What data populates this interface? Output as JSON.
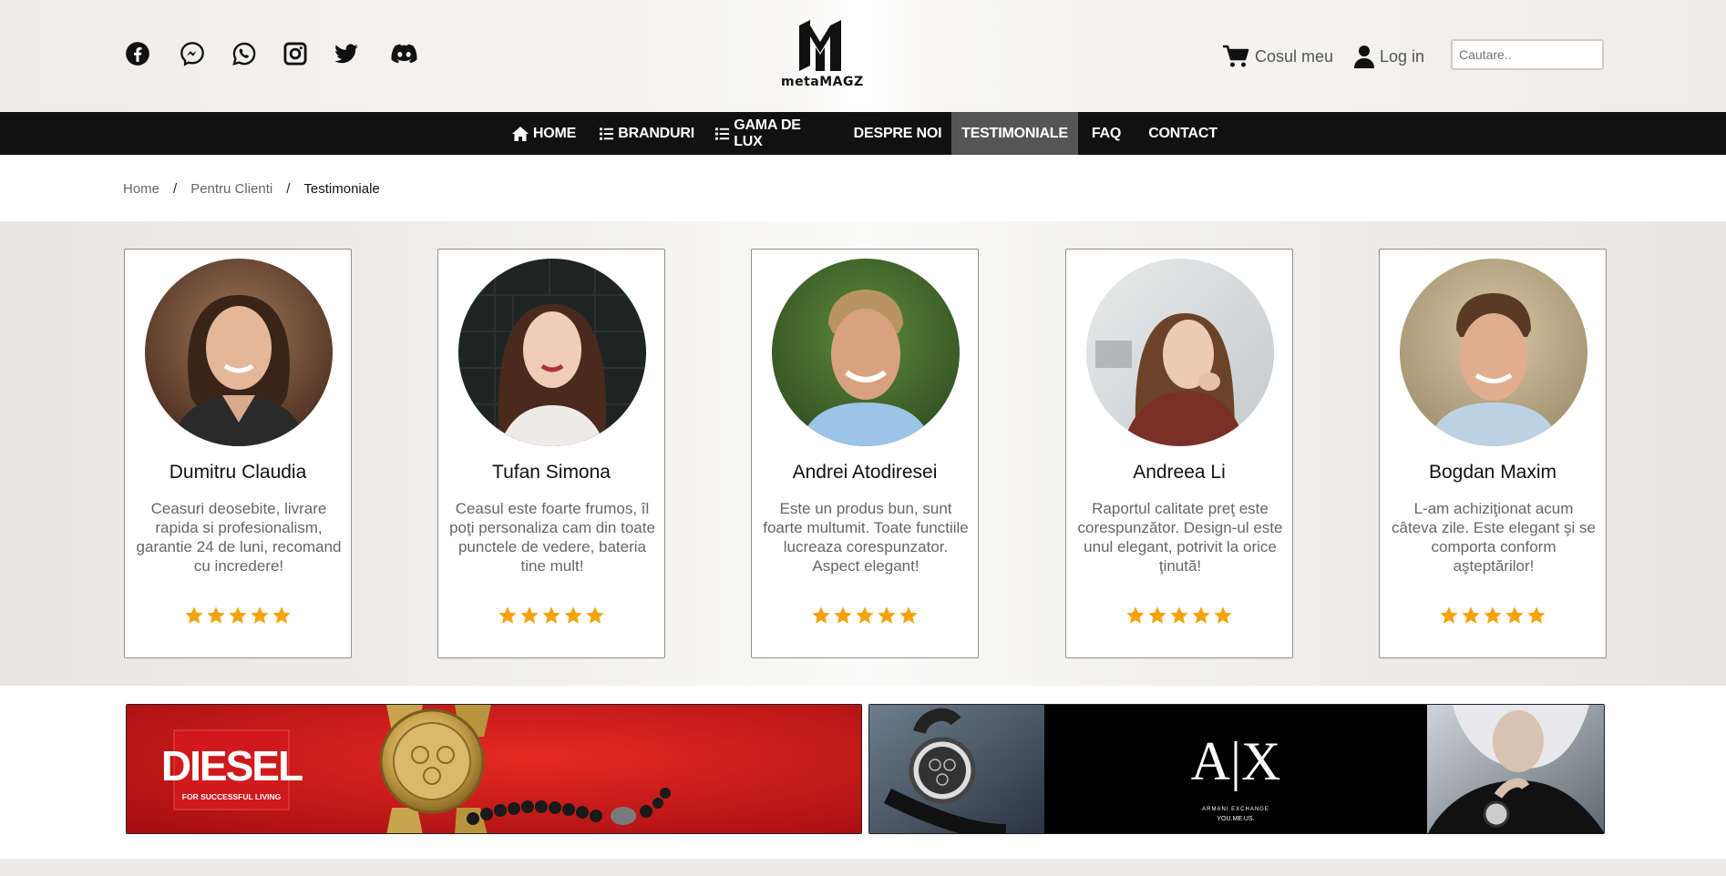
{
  "header": {
    "social_icons": [
      "facebook-icon",
      "messenger-icon",
      "whatsapp-icon",
      "instagram-icon",
      "twitter-icon",
      "discord-icon"
    ],
    "logo_text": "metaMAGZ",
    "cart_label": "Cosul meu",
    "login_label": "Log in",
    "search_placeholder": "Cautare.."
  },
  "nav": {
    "items": [
      {
        "label": "HOME",
        "icon": "home-icon"
      },
      {
        "label": "BRANDURI",
        "icon": "list-icon"
      },
      {
        "label": "GAMA DE LUX",
        "icon": "list-icon"
      },
      {
        "label": "DESPRE NOI"
      },
      {
        "label": "TESTIMONIALE",
        "active": true
      },
      {
        "label": "FAQ"
      },
      {
        "label": "CONTACT"
      }
    ]
  },
  "breadcrumb": {
    "home": "Home",
    "section": "Pentru Clienti",
    "current": "Testimoniale",
    "separator": "/"
  },
  "testimonials": [
    {
      "name": "Dumitru Claudia",
      "text": "Ceasuri deosebite, livrare rapida si profesionalism, garantie 24 de luni, recomand cu incredere!",
      "rating": 5
    },
    {
      "name": "Tufan Simona",
      "text": "Ceasul este foarte frumos, îl poţi personaliza cam din toate punctele de vedere, bateria tine mult!",
      "rating": 5
    },
    {
      "name": "Andrei Atodiresei",
      "text": "Este un produs bun, sunt foarte multumit. Toate functiile lucreaza corespunzator. Aspect elegant!",
      "rating": 5
    },
    {
      "name": "Andreea Li",
      "text": "Raportul calitate preţ este corespunzător. Design-ul este unul elegant, potrivit la orice ţinută!",
      "rating": 5
    },
    {
      "name": "Bogdan Maxim",
      "text": "L-am achiziţionat acum câteva zile. Este elegant şi se comporta conform aşteptărilor!",
      "rating": 5
    }
  ],
  "banners": {
    "diesel": {
      "brand": "DIESEL",
      "tagline": "FOR SUCCESSFUL LIVING"
    },
    "armani": {
      "brand": "A|X",
      "line1": "ARMANI EXCHANGE",
      "line2": "YOU.ME.US."
    }
  },
  "colors": {
    "nav_bg": "#111111",
    "nav_active": "#555555",
    "star": "#f5a30c",
    "diesel_red": "#d0191d"
  }
}
